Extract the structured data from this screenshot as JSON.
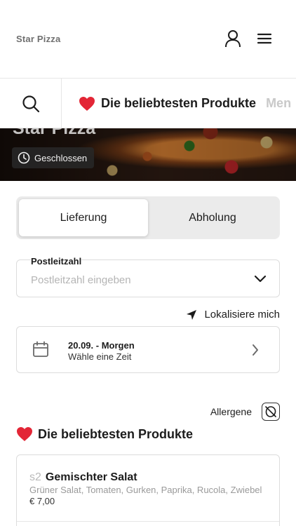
{
  "header": {
    "brand": "Star Pizza",
    "icons": {
      "user": "user-icon",
      "menu": "hamburger-menu-icon"
    }
  },
  "category_bar": {
    "search_icon": "search-icon",
    "tabs": [
      {
        "icon": "heart-icon",
        "label": "Die beliebtesten Produkte"
      },
      {
        "label": "Men"
      }
    ]
  },
  "hero": {
    "title": "Star Pizza",
    "status": "Geschlossen",
    "status_icon": "clock-icon"
  },
  "order_mode": {
    "options": [
      "Lieferung",
      "Abholung"
    ],
    "selected": "Lieferung"
  },
  "postal_code": {
    "label": "Postleitzahl",
    "placeholder": "Postleitzahl eingeben",
    "value": ""
  },
  "locate": {
    "label": "Lokalisiere mich",
    "icon": "location-arrow-icon"
  },
  "date_picker": {
    "date": "20.09. - Morgen",
    "hint": "Wähle eine Zeit",
    "icon": "calendar-icon"
  },
  "allergens": {
    "label": "Allergene",
    "icon": "allergen-icon"
  },
  "section": {
    "icon": "heart-icon",
    "title": "Die beliebtesten Produkte"
  },
  "products": [
    {
      "code": "s2",
      "name": "Gemischter Salat",
      "description": "Grüner Salat, Tomaten, Gurken, Paprika, Rucola, Zwiebel",
      "price": "€ 7,00"
    }
  ],
  "colors": {
    "accent_heart": "#e32636",
    "toggle_bg": "#ebebeb",
    "border": "#dcdcdc"
  }
}
